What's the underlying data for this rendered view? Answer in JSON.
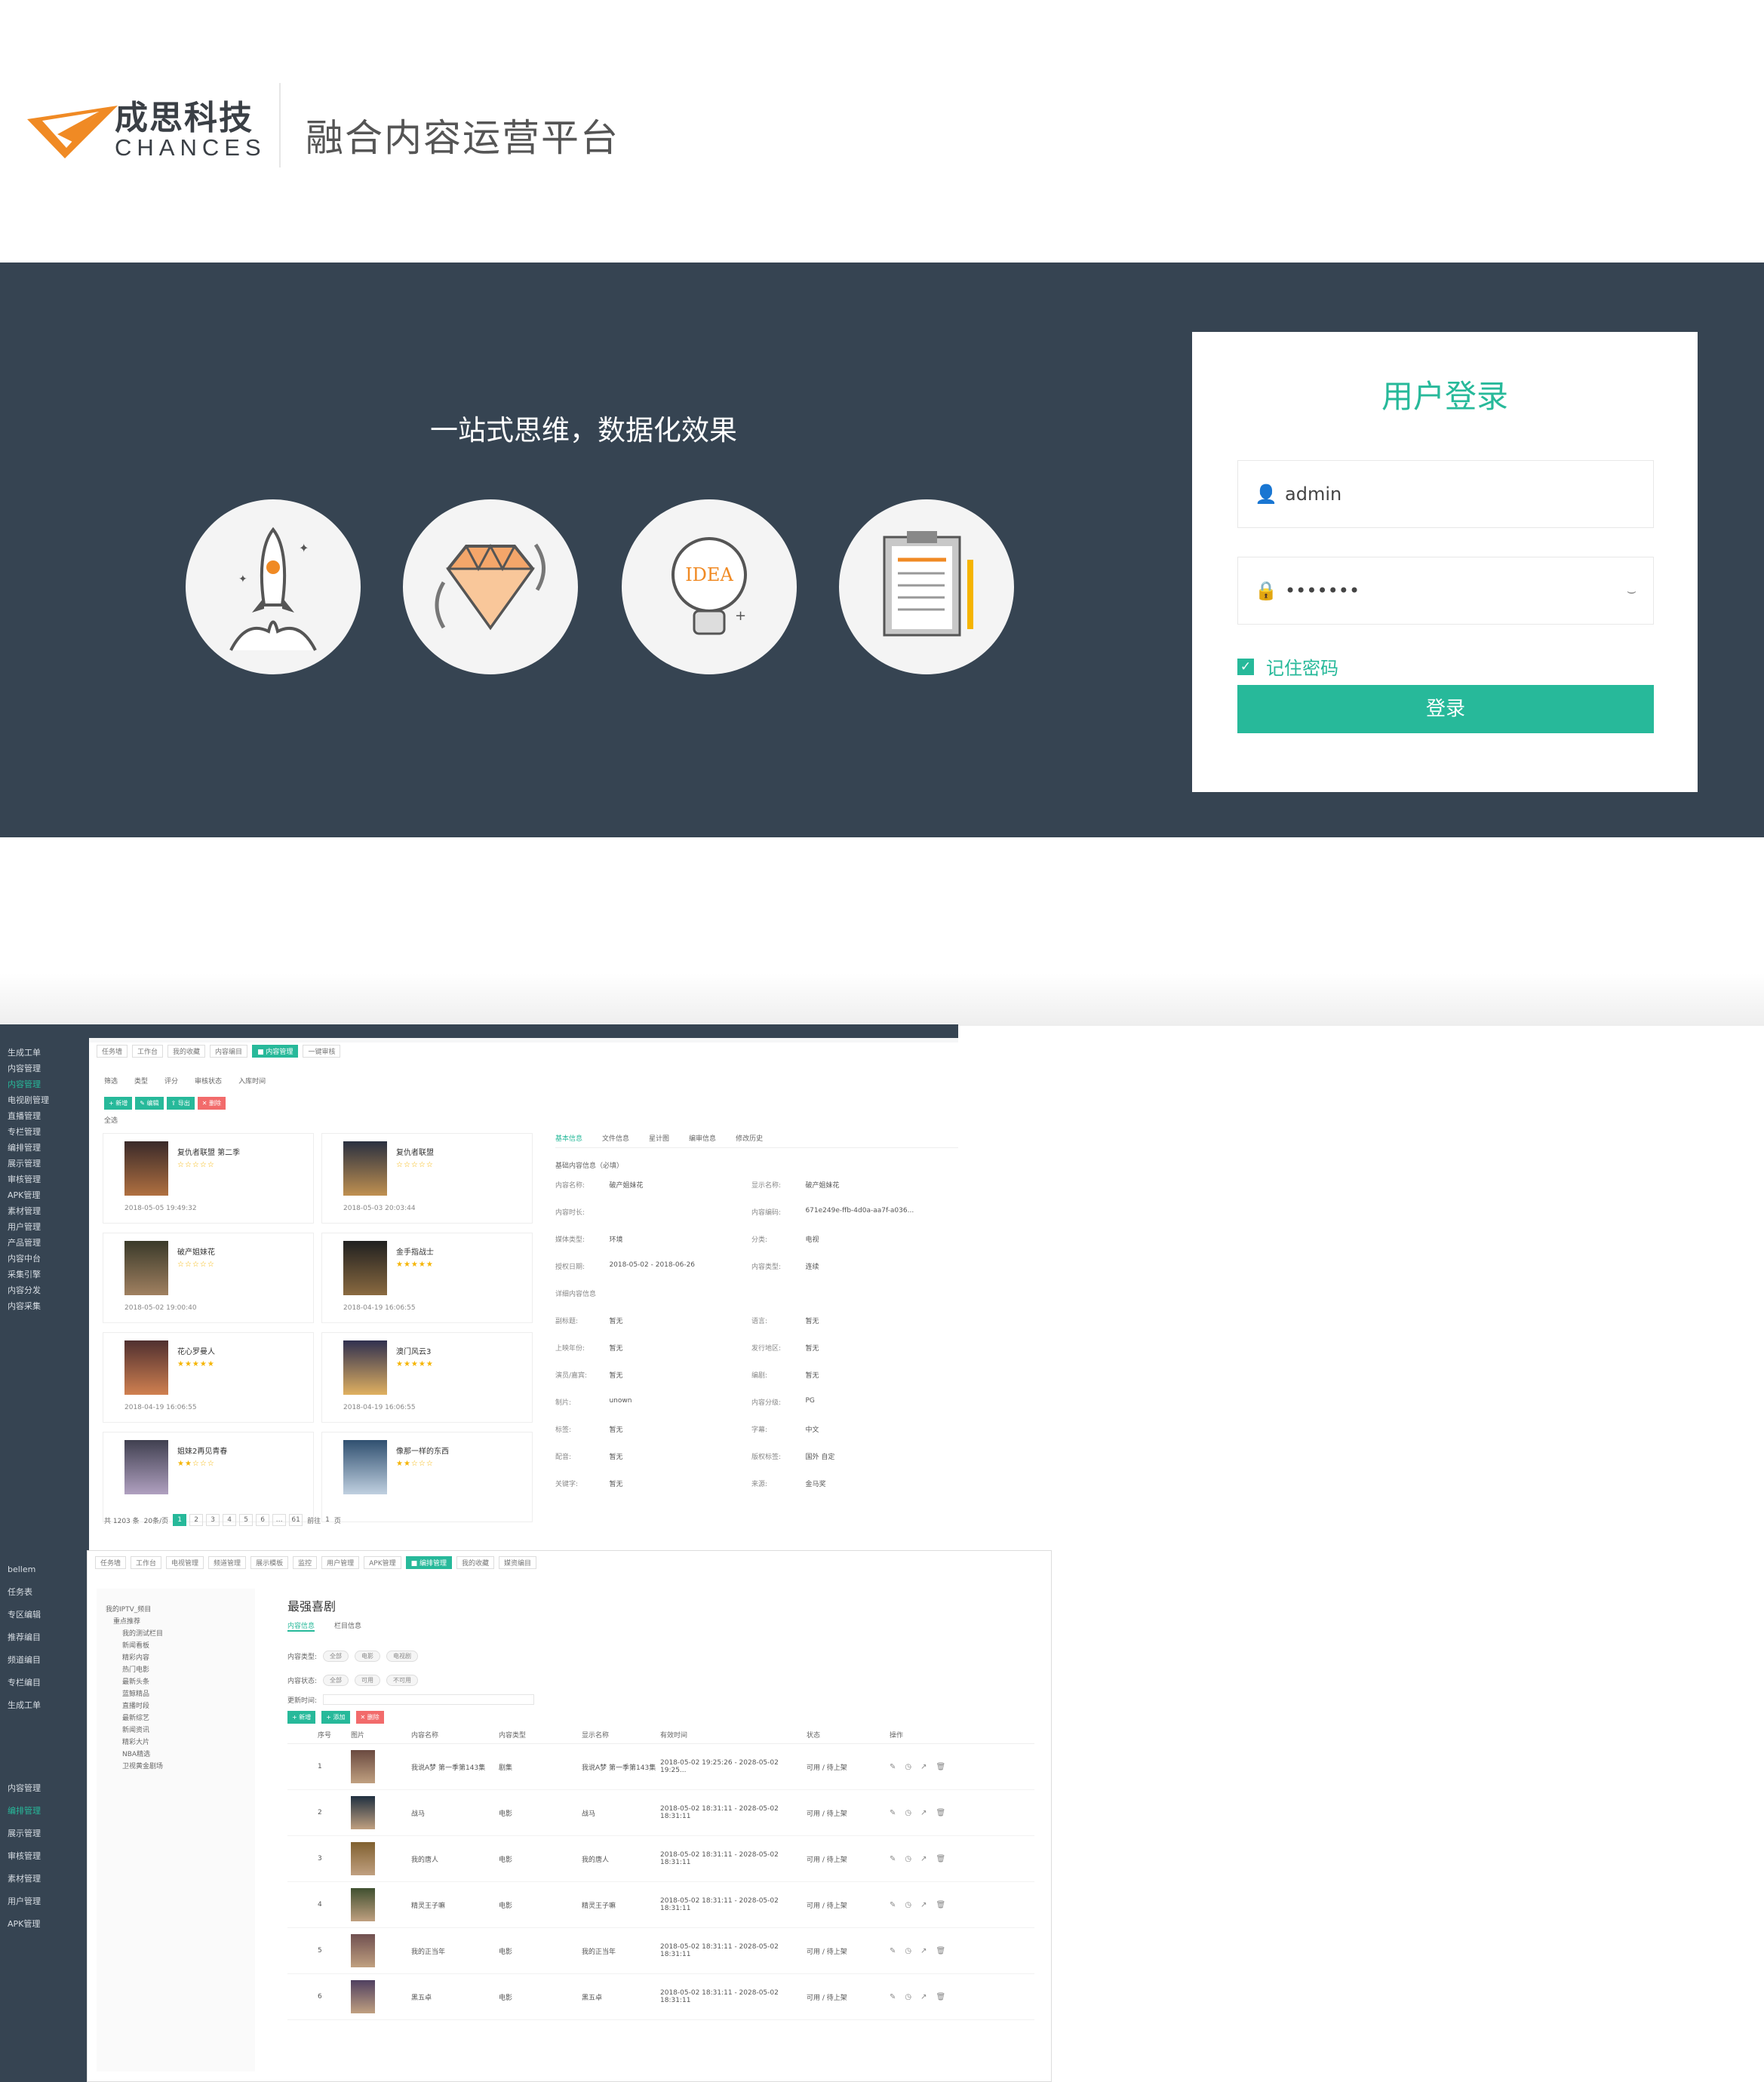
{
  "header": {
    "brand_cn": "成思科技",
    "brand_en": "CHANCES",
    "platform_title": "融合内容运营平台",
    "brand_color": "#f08a24"
  },
  "banner": {
    "slogan": "一站式思维，数据化效果",
    "background": "#364452",
    "icons": [
      "rocket-icon",
      "diamond-icon",
      "idea-bulb-icon",
      "clipboard-icon"
    ],
    "bulb_text": "IDEA"
  },
  "login": {
    "title": "用户登录",
    "username_value": "admin",
    "password_mask": "•••••••",
    "remember_label": "记住密码",
    "remember_checked": true,
    "submit_label": "登录",
    "accent": "#27b99a"
  },
  "screenshot1": {
    "tabs": [
      "任务墙",
      "工作台",
      "我的收藏",
      "内容编目",
      "■ 内容管理",
      "一键审核"
    ],
    "nav_items": [
      "生成工单",
      "内容管理",
      "内容管理",
      "电视剧管理",
      "直播管理",
      "专栏管理",
      "编排管理",
      "展示管理",
      "审核管理",
      "APK管理",
      "素材管理",
      "用户管理",
      "产品管理",
      "内容中台",
      "采集引擎",
      "内容分发",
      "内容采集"
    ],
    "filters": [
      "筛选",
      "类型",
      "评分",
      "审核状态",
      "入库时间"
    ],
    "buttons": [
      "+ 新增",
      "✎ 编辑",
      "⇪ 导出",
      "✕ 删除"
    ],
    "select_all": "全选",
    "cards": [
      {
        "title": "复仇者联盟 第二季",
        "stars": "☆☆☆☆☆",
        "date": "2018-05-05 19:49:32"
      },
      {
        "title": "复仇者联盟",
        "stars": "☆☆☆☆☆",
        "date": "2018-05-03 20:03:44"
      },
      {
        "title": "破产姐妹花",
        "stars": "☆☆☆☆☆",
        "date": "2018-05-02 19:00:40"
      },
      {
        "title": "金手指战士",
        "stars": "★★★★★",
        "date": "2018-04-19 16:06:55"
      },
      {
        "title": "花心罗曼人",
        "stars": "★★★★★",
        "date": "2018-04-19 16:06:55"
      },
      {
        "title": "澳门风云3",
        "stars": "★★★★★",
        "date": "2018-04-19 16:06:55"
      },
      {
        "title": "姐妹2再见青春",
        "stars": "★★☆☆☆",
        "date": ""
      },
      {
        "title": "像那一样的东西",
        "stars": "★★☆☆☆",
        "date": ""
      }
    ],
    "pager": {
      "total": "共 1203 条",
      "per_page": "20条/页",
      "pages": [
        "1",
        "2",
        "3",
        "4",
        "5",
        "6",
        "…",
        "61"
      ],
      "goto": "前往",
      "goto_page": "1",
      "page_suffix": "页"
    },
    "detail_tabs": [
      "基本信息",
      "文件信息",
      "星计图",
      "编审信息",
      "修改历史"
    ],
    "detail_section": "基础内容信息（必填）",
    "detail_rows": [
      {
        "k1": "内容名称:",
        "v1": "破产姐妹花",
        "k2": "显示名称:",
        "v2": "破产姐妹花"
      },
      {
        "k1": "内容时长:",
        "v1": "",
        "k2": "内容编码:",
        "v2": "671e249e-ffb-4d0a-aa7f-a036..."
      },
      {
        "k1": "媒体类型:",
        "v1": "环境",
        "k2": "分类:",
        "v2": "电视"
      },
      {
        "k1": "授权日期:",
        "v1": "2018-05-02 - 2018-06-26",
        "k2": "内容类型:",
        "v2": "连续"
      },
      {
        "k1": "详细内容信息",
        "v1": "",
        "k2": "",
        "v2": ""
      },
      {
        "k1": "副标题:",
        "v1": "暂无",
        "k2": "语言:",
        "v2": "暂无"
      },
      {
        "k1": "上映年份:",
        "v1": "暂无",
        "k2": "发行地区:",
        "v2": "暂无"
      },
      {
        "k1": "演员/嘉宾:",
        "v1": "暂无",
        "k2": "编剧:",
        "v2": "暂无"
      },
      {
        "k1": "制片:",
        "v1": "unown",
        "k2": "内容分级:",
        "v2": "PG"
      },
      {
        "k1": "标签:",
        "v1": "暂无",
        "k2": "字幕:",
        "v2": "中文"
      },
      {
        "k1": "配音:",
        "v1": "暂无",
        "k2": "版权标签:",
        "v2": "国外 自定"
      },
      {
        "k1": "关键字:",
        "v1": "暂无",
        "k2": "来源:",
        "v2": "金马奖"
      }
    ]
  },
  "screenshot2": {
    "tabs": [
      "任务墙",
      "工作台",
      "电视管理",
      "频道管理",
      "展示模板",
      "监控",
      "用户管理",
      "APK管理",
      "■ 编排管理",
      "我的收藏",
      "媒资编目"
    ],
    "nav_items": [
      "bellem",
      "任务表",
      "专区编辑",
      "推荐编目",
      "频道编目",
      "专栏编目",
      "生成工单",
      "内容管理",
      "编排管理",
      "展示管理",
      "审核管理",
      "素材管理",
      "用户管理",
      "APK管理"
    ],
    "tree": [
      "我的IPTV_频目",
      "重点推荐",
      "我的测试栏目",
      "新闻看板",
      "精彩内容",
      "热门电影",
      "最新头条",
      "蓝鲸精品",
      "直播时段",
      "最新综艺",
      "新闻资讯",
      "精彩大片",
      "NBA精选",
      "卫视黄金剧场"
    ],
    "page_title": "最强喜剧",
    "sub_tabs": [
      "内容信息",
      "栏目信息"
    ],
    "query_labels": [
      "内容类型:",
      "内容状态:",
      "更新时间:"
    ],
    "type_chips": [
      "全部",
      "电影",
      "电视剧"
    ],
    "status_chips": [
      "全部",
      "可用",
      "不可用"
    ],
    "buttons": [
      "+ 新增",
      "+ 添加",
      "✕ 删除"
    ],
    "columns": [
      "序号",
      "图片",
      "内容名称",
      "内容类型",
      "显示名称",
      "有效时间",
      "状态",
      "操作"
    ],
    "rows": [
      {
        "no": "1",
        "name": "我说A梦 第一季第143集",
        "type": "剧集",
        "show": "我说A梦 第一季第143集",
        "time": "2018-05-02 19:25:26 - 2028-05-02 19:25...",
        "status": "可用 / 待上架"
      },
      {
        "no": "2",
        "name": "战马",
        "type": "电影",
        "show": "战马",
        "time": "2018-05-02 18:31:11 - 2028-05-02 18:31:11",
        "status": "可用 / 待上架"
      },
      {
        "no": "3",
        "name": "我的唐人",
        "type": "电影",
        "show": "我的唐人",
        "time": "2018-05-02 18:31:11 - 2028-05-02 18:31:11",
        "status": "可用 / 待上架"
      },
      {
        "no": "4",
        "name": "精灵王子嘛",
        "type": "电影",
        "show": "精灵王子嘛",
        "time": "2018-05-02 18:31:11 - 2028-05-02 18:31:11",
        "status": "可用 / 待上架"
      },
      {
        "no": "5",
        "name": "我的正当年",
        "type": "电影",
        "show": "我的正当年",
        "time": "2018-05-02 18:31:11 - 2028-05-02 18:31:11",
        "status": "可用 / 待上架"
      },
      {
        "no": "6",
        "name": "黑五卓",
        "type": "电影",
        "show": "黑五卓",
        "time": "2018-05-02 18:31:11 - 2028-05-02 18:31:11",
        "status": "可用 / 待上架"
      }
    ]
  }
}
